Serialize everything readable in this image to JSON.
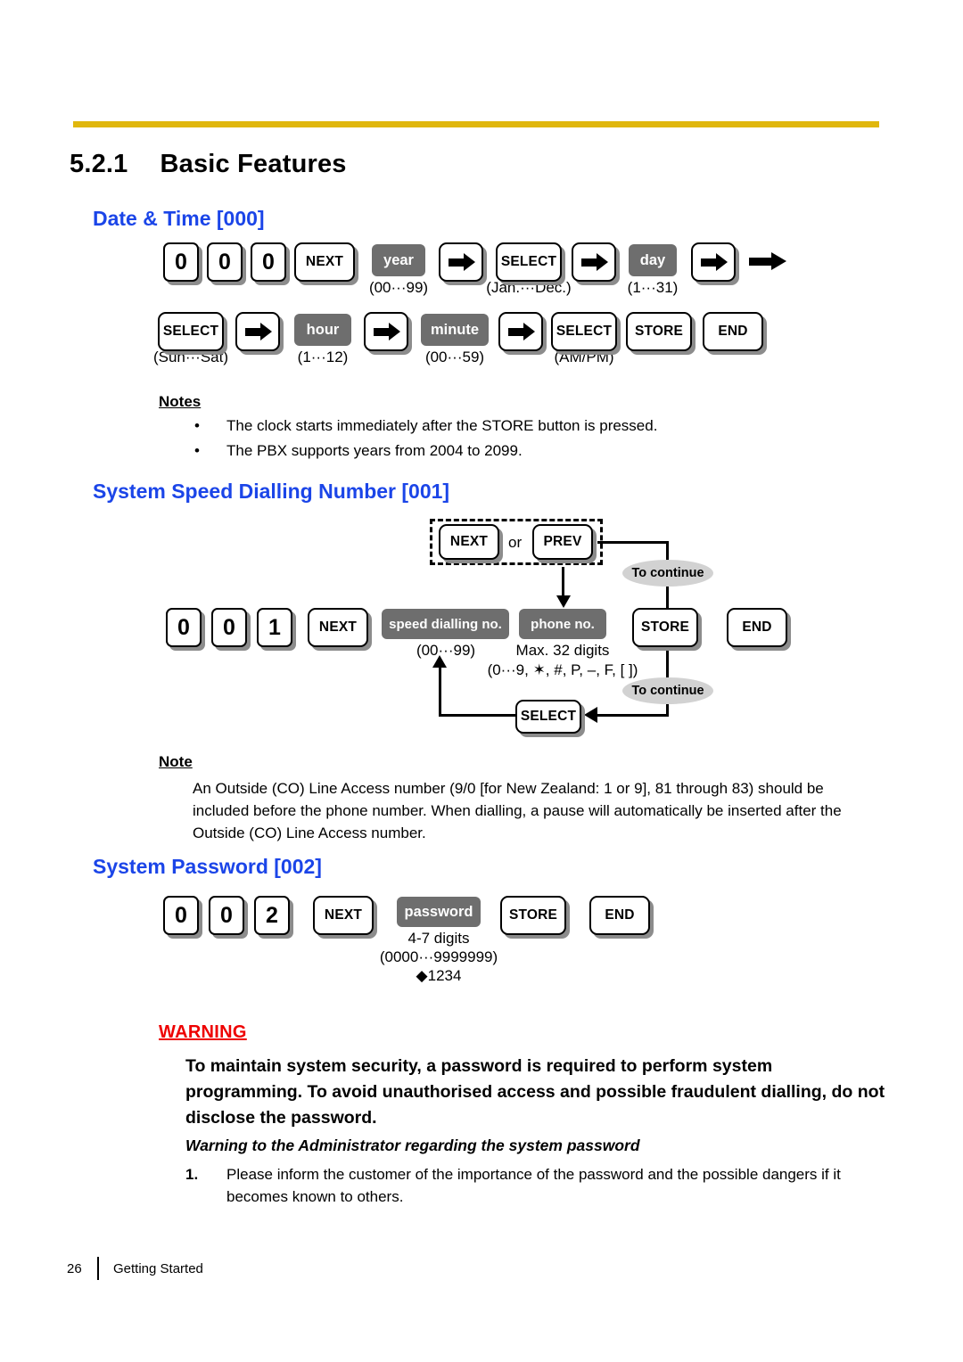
{
  "page": {
    "section_number": "5.2.1",
    "section_title": "Basic Features",
    "footer_page": "26",
    "footer_label": "Getting Started",
    "accent_rule_color": "#e0b70d",
    "heading_blue": "#1b45e8",
    "warning_red": "#ee0000",
    "grey_box_color": "#6e6e6e",
    "ellipse_color": "#d2d2d2"
  },
  "date_time": {
    "heading": "Date & Time [000]",
    "row1": {
      "digits": [
        "0",
        "0",
        "0"
      ],
      "next_label": "NEXT",
      "year_label": "year",
      "year_caption": "(00···99)",
      "select_label": "SELECT",
      "select_caption": "(Jan.···Dec.)",
      "day_label": "day",
      "day_caption": "(1···31)"
    },
    "row2": {
      "select1_label": "SELECT",
      "select1_caption": "(Sun···Sat)",
      "hour_label": "hour",
      "hour_caption": "(1···12)",
      "minute_label": "minute",
      "minute_caption": "(00···59)",
      "select2_label": "SELECT",
      "select2_caption": "(AM/PM)",
      "store_label": "STORE",
      "end_label": "END"
    },
    "notes_heading": "Notes",
    "notes": [
      "The clock starts immediately after the STORE button is pressed.",
      "The PBX supports years from 2004 to 2099."
    ],
    "bullet_char": "•"
  },
  "speed_dialling": {
    "heading": "System Speed Dialling Number [001]",
    "digits": [
      "0",
      "0",
      "1"
    ],
    "next_label": "NEXT",
    "speed_no_label": "speed dialling no.",
    "speed_no_caption": "(00···99)",
    "phone_no_label": "phone no.",
    "phone_caption_line1": "Max. 32 digits",
    "phone_caption_line2": "(0···9, ✶, #, P, –, F, [ ])",
    "store_label": "STORE",
    "end_label": "END",
    "select_label": "SELECT",
    "dashed_next_label": "NEXT",
    "dashed_or_label": "or",
    "dashed_prev_label": "PREV",
    "to_continue_top": "To continue",
    "to_continue_bottom": "To continue",
    "note_heading": "Note",
    "note_body": "An Outside (CO) Line Access number (9/0 [for New Zealand: 1 or 9], 81 through 83) should be included before the phone number. When dialling, a pause will automatically be inserted after the Outside (CO) Line Access number."
  },
  "system_password": {
    "heading": "System Password [002]",
    "digits": [
      "0",
      "0",
      "2"
    ],
    "next_label": "NEXT",
    "password_label": "password",
    "caption_line1": "4-7 digits",
    "caption_line2": "(0000···9999999)",
    "caption_line3": "◆1234",
    "store_label": "STORE",
    "end_label": "END"
  },
  "warning": {
    "title": "WARNING",
    "body": "To maintain system security, a password is required to perform system programming. To avoid unauthorised access and possible fraudulent dialling, do not disclose the password.",
    "subtitle": "Warning to the Administrator regarding the system password",
    "items": [
      {
        "index": "1.",
        "text": "Please inform the customer of the importance of the password and the possible dangers if it becomes known to others."
      }
    ]
  }
}
